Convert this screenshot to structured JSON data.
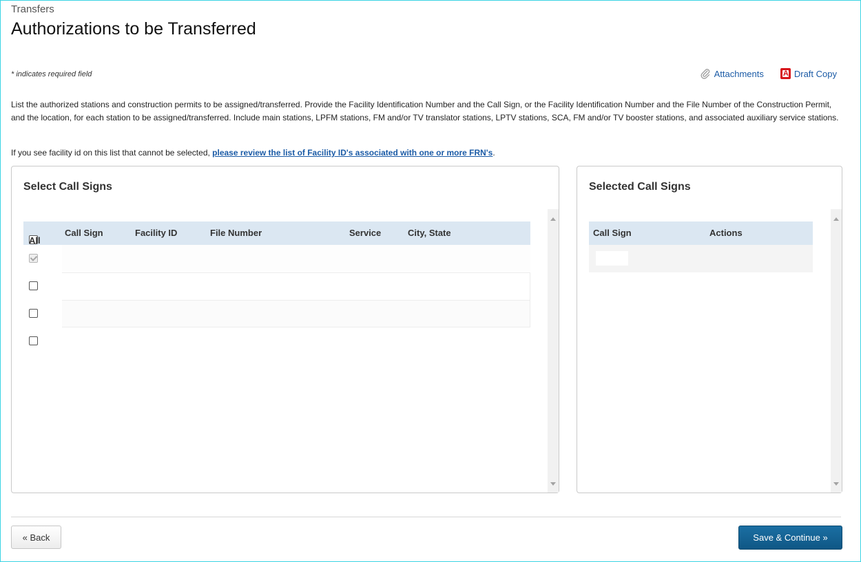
{
  "breadcrumb": "Transfers",
  "page_title": "Authorizations to be Transferred",
  "required_note": "* indicates required field",
  "top_links": {
    "attachments": "Attachments",
    "draft_copy": "Draft Copy"
  },
  "description": "List the authorized stations and construction permits to be assigned/transferred. Provide the Facility Identification Number and the Call Sign, or the Facility Identification Number and the File Number of the Construction Permit, and the location, for each station to be assigned/transferred. Include main stations, LPFM stations, FM and/or TV translator stations, LPTV stations, SCA, FM and/or TV booster stations, and associated auxiliary service stations.",
  "facility_note": {
    "text": "If you see facility id on this list that cannot be selected, ",
    "link": "please review the list of Facility ID's associated with one or more FRN's",
    "suffix": "."
  },
  "select_panel": {
    "title": "Select Call Signs",
    "all_label": "All",
    "columns": [
      "Call Sign",
      "Facility ID",
      "File Number",
      "Service",
      "City, State"
    ],
    "rows": [
      {
        "checked": true,
        "disabled": true
      },
      {
        "checked": false,
        "disabled": false
      },
      {
        "checked": false,
        "disabled": false
      },
      {
        "checked": false,
        "disabled": false
      }
    ]
  },
  "selected_panel": {
    "title": "Selected Call Signs",
    "columns": [
      "Call Sign",
      "Actions"
    ]
  },
  "buttons": {
    "back": "« Back",
    "save": "Save & Continue »"
  },
  "colors": {
    "frame_border": "#39d3e3",
    "link": "#1b5ba6",
    "header_bg": "#dbe7f2",
    "primary_button": "#1b6fa3"
  }
}
